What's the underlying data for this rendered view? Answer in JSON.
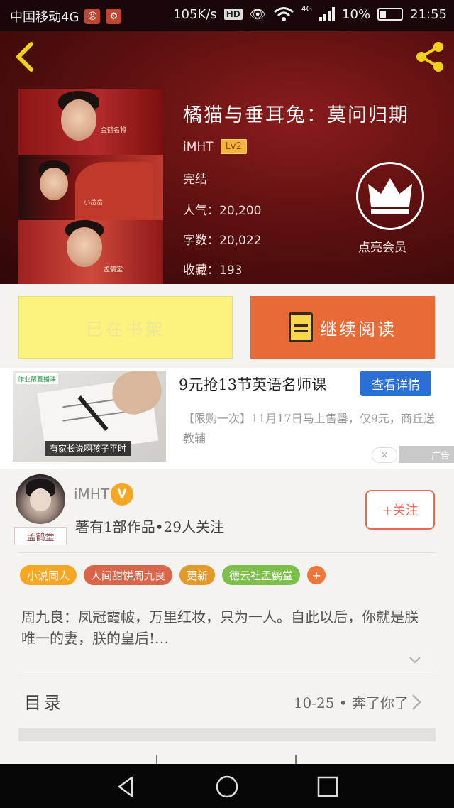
{
  "status_bar": {
    "carrier": "中国移动4G",
    "speed": "105K/s",
    "hd": "HD",
    "net": "4G",
    "battery": "10%",
    "time": "21:55"
  },
  "book": {
    "title": "橘猫与垂耳兔：莫问归期",
    "author": "iMHT",
    "level": "Lv2",
    "status": "完结",
    "popularity": "人气：20,200",
    "word_count": "字数：20,022",
    "favorites": "收藏：193",
    "cover_captions": [
      "金鹤名将",
      "小岳岳",
      "孟鹤堂"
    ],
    "vip_label": "点亮会员"
  },
  "actions": {
    "shelf_label": "已在书架",
    "read_label": "继续阅读"
  },
  "ad": {
    "tag": "作业帮直播课",
    "caption": "有家长说啊孩子平时",
    "title": "9元抢13节英语名师课",
    "cta": "查看详情",
    "desc": "【限购一次】11月17日马上售罄，仅9元，商丘送教辅",
    "close": "×",
    "label": "广告"
  },
  "author_card": {
    "name": "iMHT",
    "verified": "V",
    "badge": "孟鹤堂",
    "stats": "著有1部作品•29人关注",
    "follow": "+关注"
  },
  "tags": [
    {
      "label": "小说同人",
      "color": "#f5a623"
    },
    {
      "label": "人间甜饼周九良",
      "color": "#d9654a"
    },
    {
      "label": "更新",
      "color": "#e39a2b"
    },
    {
      "label": "德云社孟鹤堂",
      "color": "#7cbf4b"
    }
  ],
  "tag_more": "+",
  "synopsis": "周九良：凤冠霞帔，万里红妆，只为一人。自此以后，你就是朕唯一的妻，朕的皇后!…",
  "toc": {
    "label": "目录",
    "latest": "10-25 • 奔了你了"
  },
  "colors": {
    "accent": "#e86a36",
    "shelf": "#fbf37e",
    "cta_blue": "#2a6fd6"
  }
}
